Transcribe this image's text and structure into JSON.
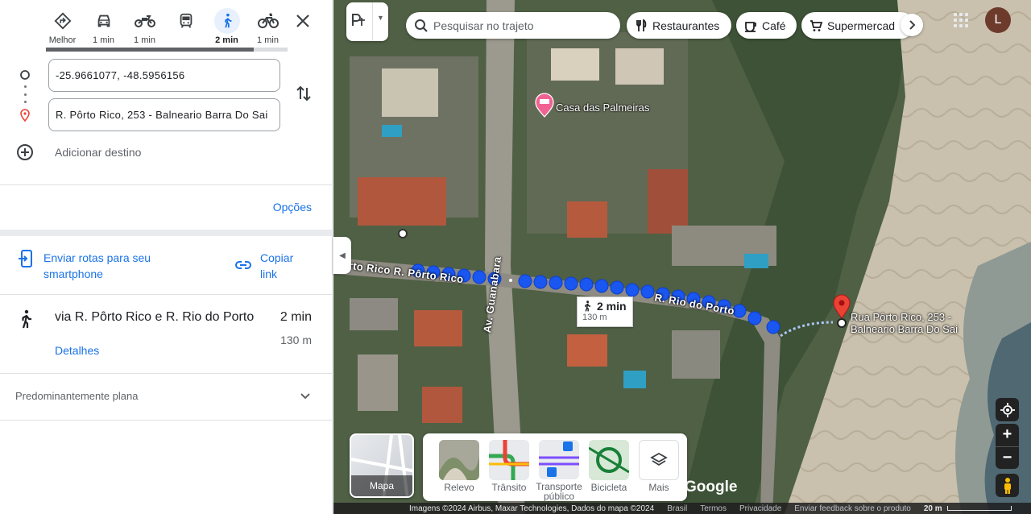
{
  "travel_modes": [
    {
      "name": "best",
      "label": "Melhor",
      "icon": "directions-diamond-icon",
      "selected": false
    },
    {
      "name": "car",
      "label": "1 min",
      "icon": "car-icon",
      "selected": false
    },
    {
      "name": "motorcycle",
      "label": "1 min",
      "icon": "motorcycle-icon",
      "selected": false
    },
    {
      "name": "transit",
      "label": "",
      "icon": "train-icon",
      "selected": false
    },
    {
      "name": "walk",
      "label": "2 min",
      "icon": "walk-icon",
      "selected": true
    },
    {
      "name": "bike",
      "label": "1 min",
      "icon": "bicycle-icon",
      "selected": false
    }
  ],
  "origin": {
    "value": "-25.9661077, -48.5956156"
  },
  "destination": {
    "value": "R. Pôrto Rico, 253 - Balneario Barra Do Sai"
  },
  "add_destination": "Adicionar destino",
  "options_link": "Opções",
  "send_to_phone": "Enviar rotas para seu smartphone",
  "copy_link": "Copiar link",
  "route": {
    "title": "via R. Pôrto Rico e R. Rio do Porto",
    "time": "2 min",
    "distance": "130 m",
    "details_link": "Detalhes",
    "terrain": "Predominantemente plana"
  },
  "map": {
    "search_placeholder": "Pesquisar no trajeto",
    "chips": [
      "Restaurantes",
      "Café",
      "Supermercad"
    ],
    "avatar_letter": "L",
    "poi": "Casa das Palmeiras",
    "streets": {
      "porto_rico": "orto Rico R. Pôrto Rico",
      "rio_do_porto": "R. Rio do Porto",
      "guanabara": "Av. Guanabara"
    },
    "bubble": {
      "time": "2 min",
      "distance": "130 m"
    },
    "destination_label_line1": "Rua Pôrto Rico, 253 -",
    "destination_label_line2": "Balneario Barra Do Sai",
    "map_type_label": "Mapa",
    "layers": [
      {
        "label": "Relevo"
      },
      {
        "label": "Trânsito"
      },
      {
        "label": "Transporte público"
      },
      {
        "label": "Bicicleta"
      },
      {
        "label": "Mais"
      }
    ],
    "google_text": "Google",
    "footer": {
      "attribution": "Imagens ©2024 Airbus, Maxar Technologies, Dados do mapa ©2024",
      "country": "Brasil",
      "terms": "Termos",
      "privacy": "Privacidade",
      "feedback": "Enviar feedback sobre o produto",
      "scale": "20 m"
    }
  },
  "colors": {
    "accent": "#1a73e8",
    "route": "#1a56f0",
    "pin": "#ea4335"
  }
}
